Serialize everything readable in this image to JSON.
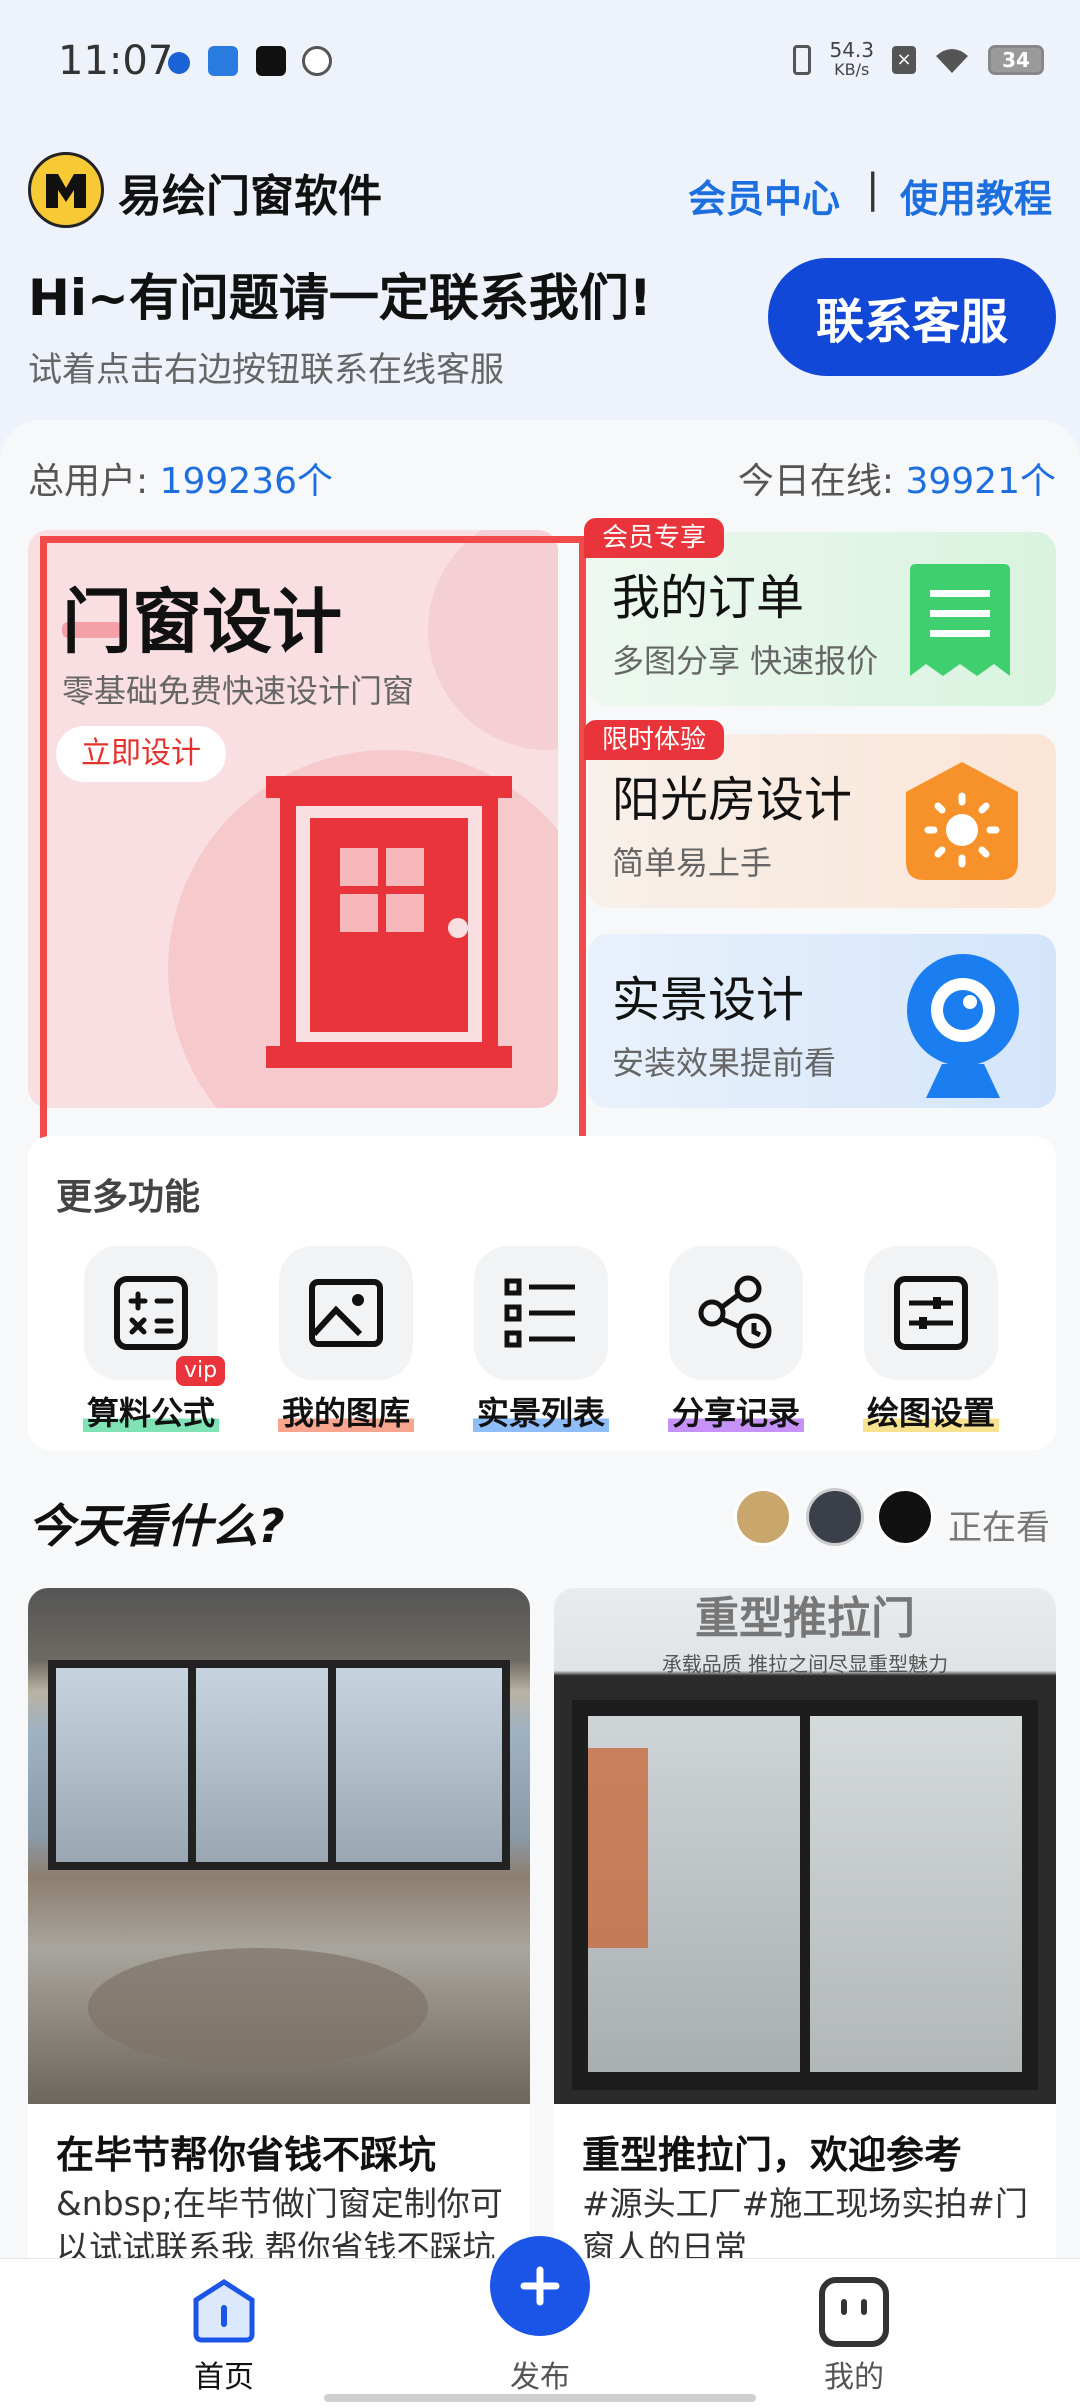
{
  "status": {
    "time": "11:07",
    "net_speed": "54.3",
    "net_unit": "KB/s",
    "battery": "34"
  },
  "header": {
    "brand": "易绘门窗软件",
    "member_link": "会员中心",
    "separator": "|",
    "tutorial_link": "使用教程"
  },
  "greeting": {
    "title": "Hi~有问题请一定联系我们!",
    "subtitle": "试着点击右边按钮联系在线客服",
    "contact_button": "联系客服"
  },
  "stats": {
    "total_label": "总用户:",
    "total_value": "199236个",
    "online_label": "今日在线:",
    "online_value": "39921个"
  },
  "design_card": {
    "title": "门窗设计",
    "subtitle": "零基础免费快速设计门窗",
    "button": "立即设计"
  },
  "cards": [
    {
      "tag": "会员专享",
      "title": "我的订单",
      "subtitle": "多图分享 快速报价",
      "icon": "receipt-icon",
      "color": "#3fcf6e"
    },
    {
      "tag": "限时体验",
      "title": "阳光房设计",
      "subtitle": "简单易上手",
      "icon": "sun-icon",
      "color": "#f7922a"
    },
    {
      "tag": "",
      "title": "实景设计",
      "subtitle": "安装效果提前看",
      "icon": "camera-icon",
      "color": "#1a7ef0"
    }
  ],
  "more": {
    "title": "更多功能",
    "items": [
      {
        "label": "算料公式",
        "icon": "calculator-icon",
        "badge": "vip",
        "underline": "#7fe3b5"
      },
      {
        "label": "我的图库",
        "icon": "image-icon",
        "badge": "",
        "underline": "#f7a58f"
      },
      {
        "label": "实景列表",
        "icon": "list-icon",
        "badge": "",
        "underline": "#8fbdf7"
      },
      {
        "label": "分享记录",
        "icon": "share-icon",
        "badge": "",
        "underline": "#c792f7"
      },
      {
        "label": "绘图设置",
        "icon": "sliders-icon",
        "badge": "",
        "underline": "#f7e38f"
      }
    ]
  },
  "today": {
    "title": "今天看什么?",
    "watching": "正在看"
  },
  "feed": [
    {
      "title": "在毕节帮你省钱不踩坑",
      "desc": "&nbsp;在毕节做门窗定制你可以试试联系我 帮你省钱不踩坑"
    },
    {
      "title": "重型推拉门，欢迎参考",
      "desc": "#源头工厂#施工现场实拍#门窗人的日常",
      "image_heading": "重型推拉门",
      "image_caption": "承载品质  推拉之间尽显重型魅力"
    }
  ],
  "nav": {
    "home": "首页",
    "publish": "发布",
    "mine": "我的"
  }
}
